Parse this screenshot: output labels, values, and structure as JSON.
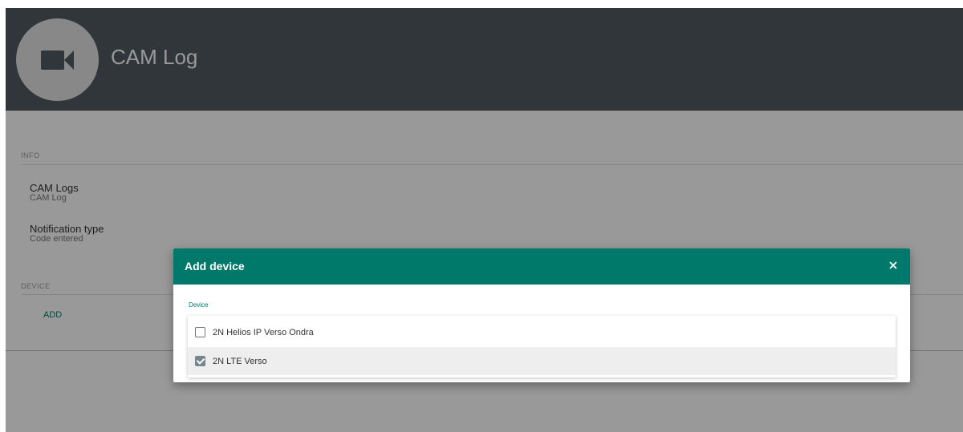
{
  "header": {
    "title": "CAM Log",
    "icon": "video-camera-icon"
  },
  "info": {
    "section_label": "INFO",
    "fields": [
      {
        "label": "CAM Logs",
        "value": "CAM Log"
      },
      {
        "label": "Notification type",
        "value": "Code entered"
      }
    ]
  },
  "device_section": {
    "section_label": "DEVICE",
    "add_label": "ADD"
  },
  "dialog": {
    "title": "Add device",
    "close_icon": "close-icon",
    "field_label": "Device",
    "options": [
      {
        "label": "2N Helios IP Verso Ondra",
        "checked": false
      },
      {
        "label": "2N LTE Verso",
        "checked": true
      }
    ]
  },
  "colors": {
    "header_bg": "#505a60",
    "dialog_header_bg": "#00796b",
    "accent": "#00796b"
  }
}
